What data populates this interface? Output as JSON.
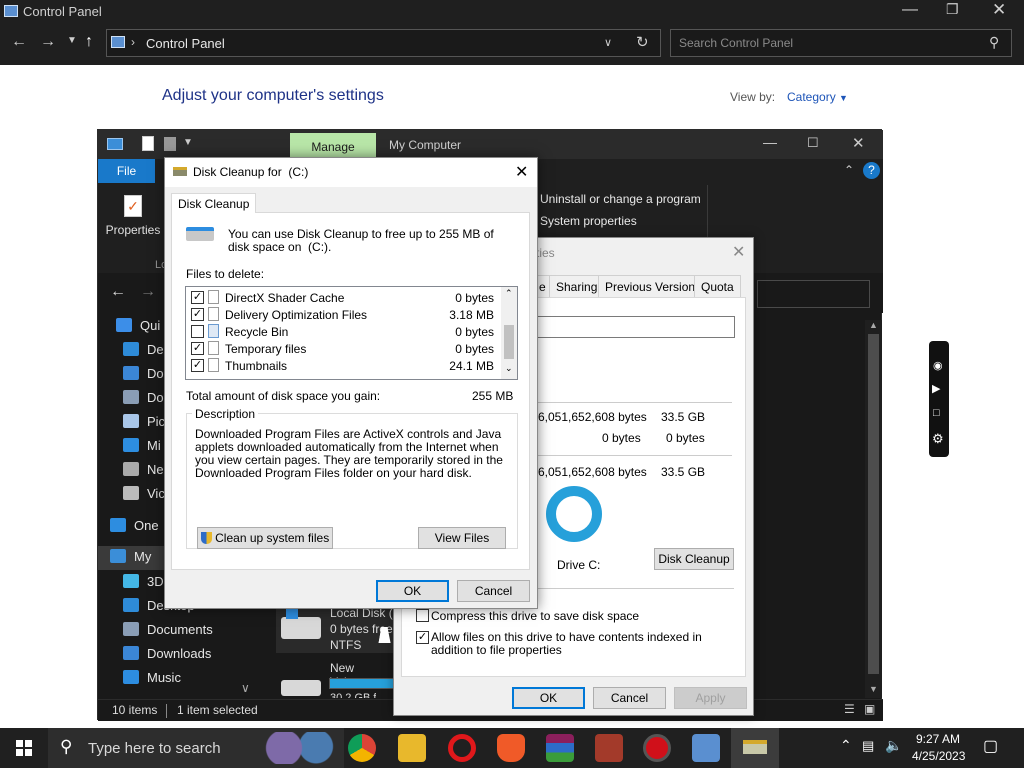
{
  "control_panel": {
    "title": "Control Panel",
    "breadcrumb": "Control Panel",
    "search_placeholder": "Search Control Panel",
    "heading": "Adjust your computer's settings",
    "view_by_label": "View by:",
    "view_by_value": "Category"
  },
  "explorer": {
    "ribbon_manage": "Manage",
    "title": "My Computer",
    "tab_file": "File",
    "properties_label": "Properties",
    "ribbon_loc_fragment": "Lo",
    "uninstall_label": "Uninstall or change a program",
    "system_props_label": "System properties",
    "sidebar": [
      {
        "label": "Qui",
        "color": "#3c8ee8"
      },
      {
        "label": "De",
        "color": "#2e8bd8"
      },
      {
        "label": "Do",
        "color": "#3b86d6"
      },
      {
        "label": "Do",
        "color": "#8a9db5"
      },
      {
        "label": "Pic",
        "color": "#a9c6e8"
      },
      {
        "label": "Mi",
        "color": "#2d8de0"
      },
      {
        "label": "Ne",
        "color": "#aaaaaa"
      },
      {
        "label": "Vic",
        "color": "#bbbbbb"
      },
      {
        "label": "One",
        "color": "#2d8de0"
      },
      {
        "label": "My",
        "color": "#3b8ed8"
      },
      {
        "label": "3D",
        "color": "#44b7e6"
      },
      {
        "label": "Desktop",
        "color": "#2e8bd8"
      },
      {
        "label": "Documents",
        "color": "#8a9db5"
      },
      {
        "label": "Downloads",
        "color": "#3b86d6"
      },
      {
        "label": "Music",
        "color": "#2d8de0"
      }
    ],
    "drive1_name": "Local Disk (",
    "drive1_free": "0 bytes free",
    "drive1_fs": "NTFS",
    "drive2_name": "New Volume",
    "drive2_free": "30.2 GB f",
    "status_items": "10 items",
    "status_selected": "1 item selected"
  },
  "properties": {
    "title_fragment": "rties",
    "tabs": [
      "e",
      "Sharing",
      "Previous Versions",
      "Quota"
    ],
    "used_bytes": "6,051,652,608 bytes",
    "used_gb": "33.5 GB",
    "free_bytes": "0 bytes",
    "free_gb": "0 bytes",
    "capacity_bytes": "6,051,652,608 bytes",
    "capacity_gb": "33.5 GB",
    "drive_label": "Drive C:",
    "disk_cleanup_button": "Disk Cleanup",
    "compress_label": "Compress this drive to save disk space",
    "index_label": "Allow files on this drive to have contents indexed in addition to file properties",
    "compress_checked": false,
    "index_checked": true,
    "ok": "OK",
    "cancel": "Cancel",
    "apply": "Apply"
  },
  "disk_cleanup": {
    "title": "Disk Cleanup for  (C:)",
    "tab": "Disk Cleanup",
    "intro": "You can use Disk Cleanup to free up to 255 MB of disk space on  (C:).",
    "files_to_delete_label": "Files to delete:",
    "files": [
      {
        "name": "DirectX Shader Cache",
        "size": "0 bytes",
        "checked": true
      },
      {
        "name": "Delivery Optimization Files",
        "size": "3.18 MB",
        "checked": true
      },
      {
        "name": "Recycle Bin",
        "size": "0 bytes",
        "checked": false
      },
      {
        "name": "Temporary files",
        "size": "0 bytes",
        "checked": true
      },
      {
        "name": "Thumbnails",
        "size": "24.1 MB",
        "checked": true
      }
    ],
    "total_label": "Total amount of disk space you gain:",
    "total_value": "255 MB",
    "description_label": "Description",
    "description_text": "Downloaded Program Files are ActiveX controls and Java applets downloaded automatically from the Internet when you view certain pages. They are temporarily stored in the Downloaded Program Files folder on your hard disk.",
    "cleanup_system_button": "Clean up system files",
    "view_files_button": "View Files",
    "ok": "OK",
    "cancel": "Cancel"
  },
  "taskbar": {
    "search_placeholder": "Type here to search",
    "time": "9:27 AM",
    "date": "4/25/2023"
  }
}
